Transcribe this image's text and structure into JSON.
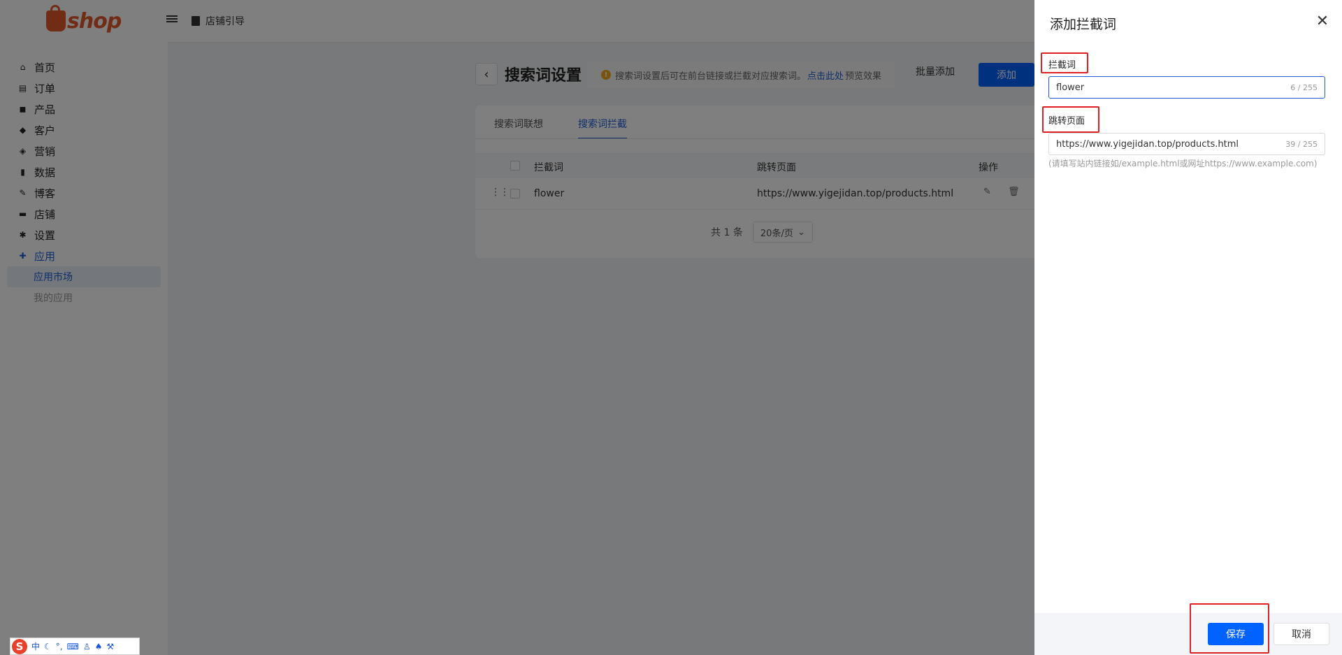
{
  "app": {
    "logo_text": "shop",
    "guide_label": "店铺引导"
  },
  "sidebar": {
    "items": [
      {
        "label": "首页",
        "icon": "home-icon"
      },
      {
        "label": "订单",
        "icon": "clipboard-icon"
      },
      {
        "label": "产品",
        "icon": "bag-icon"
      },
      {
        "label": "客户",
        "icon": "diamond-icon"
      },
      {
        "label": "营销",
        "icon": "tag-icon"
      },
      {
        "label": "数据",
        "icon": "bar-chart-icon"
      },
      {
        "label": "博客",
        "icon": "edit-icon"
      },
      {
        "label": "店铺",
        "icon": "store-icon"
      },
      {
        "label": "设置",
        "icon": "gear-icon"
      },
      {
        "label": "应用",
        "icon": "puzzle-icon"
      }
    ],
    "sub_items": [
      {
        "label": "应用市场"
      },
      {
        "label": "我的应用"
      }
    ]
  },
  "page": {
    "title": "搜索词设置",
    "notice_prefix": "搜索词设置后可在前台链接或拦截对应搜索词。",
    "notice_link": "点击此处",
    "notice_suffix": "预览效果",
    "batch_add": "批量添加",
    "add": "添加",
    "tabs": [
      {
        "label": "搜索词联想"
      },
      {
        "label": "搜索词拦截"
      }
    ],
    "table": {
      "headers": {
        "word": "拦截词",
        "page": "跳转页面",
        "ops": "操作"
      },
      "rows": [
        {
          "word": "flower",
          "page": "https://www.yigejidan.top/products.html"
        }
      ]
    },
    "pager": {
      "total": "共 1 条",
      "page_size": "20条/页"
    }
  },
  "drawer": {
    "title": "添加拦截词",
    "fields": {
      "word": {
        "label": "拦截词",
        "value": "flower",
        "count": "6 / 255"
      },
      "page": {
        "label": "跳转页面",
        "value": "https://www.yigejidan.top/products.html",
        "count": "39 / 255"
      }
    },
    "hint": "(请填写站内链接如/example.html或网址https://www.example.com)",
    "save": "保存",
    "cancel": "取消"
  },
  "ime": {
    "lang": "中"
  },
  "colors": {
    "primary": "#0062ff",
    "highlight": "#e02020",
    "brand": "#e3582b"
  }
}
